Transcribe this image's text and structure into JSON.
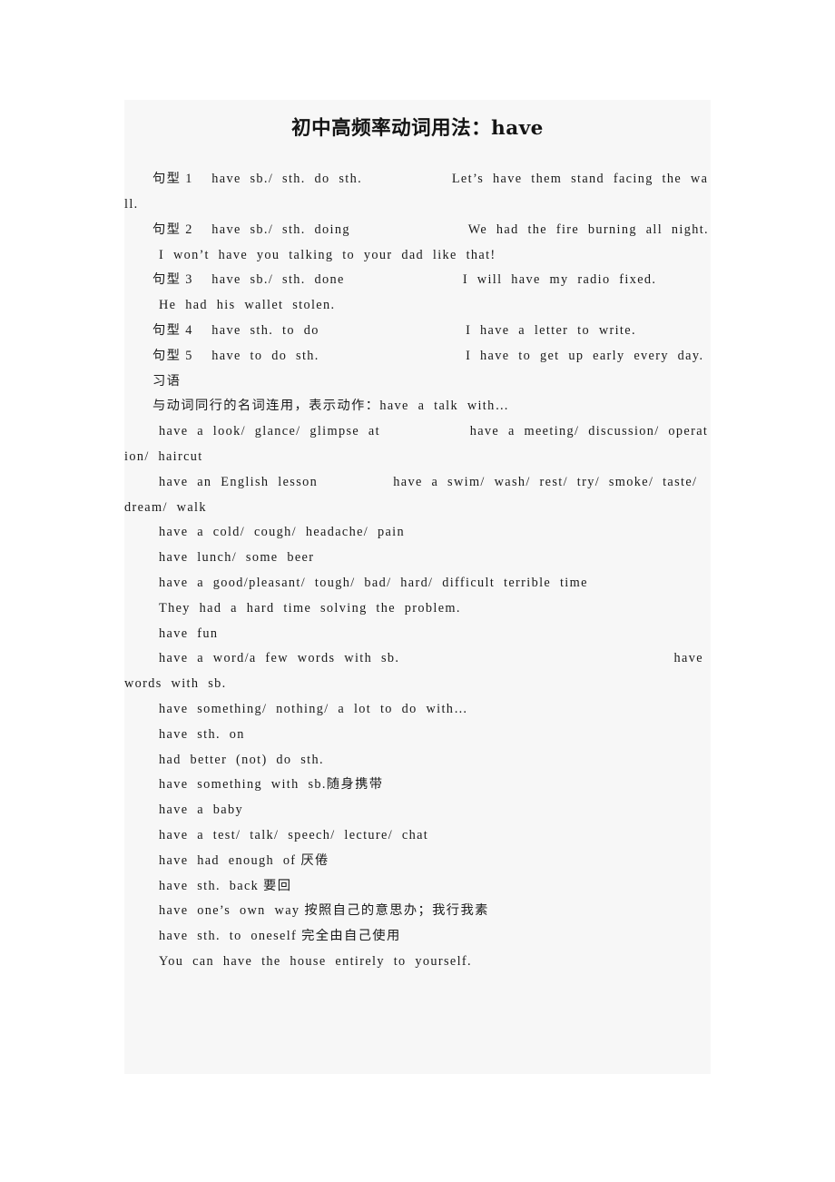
{
  "document": {
    "title": "初中高频率动词用法：have",
    "background_color": "#f7f7f7",
    "page_color": "#ffffff",
    "text_color": "#1a1a1a",
    "lines": [
      {
        "id": "pattern-1",
        "indent": "hang-pat",
        "text": "句型 1　 have  sb./  sth.  do  sth.　　　　　　 Let’s  have  them  stand  facing  the  wall."
      },
      {
        "id": "pattern-2",
        "indent": "hang-pat",
        "text": "句型 2　 have  sb./  sth.  doing　　　　　　　　 We  had  the  fire  burning  all  night."
      },
      {
        "id": "example-2b",
        "indent": "hang-item",
        "text": "I  won’t  have  you  talking  to  your  dad  like  that!"
      },
      {
        "id": "pattern-3",
        "indent": "hang-pat",
        "text": "句型 3　 have  sb./  sth.  done　　　　　　　　 I  will  have  my  radio  fixed."
      },
      {
        "id": "example-3b",
        "indent": "hang-item",
        "text": "He  had  his  wallet  stolen."
      },
      {
        "id": "pattern-4",
        "indent": "hang-pat",
        "text": "句型 4　 have  sth.  to  do　　　　　　　　　　 I  have  a  letter  to  write."
      },
      {
        "id": "pattern-5",
        "indent": "hang-pat",
        "text": "句型 5　 have  to  do  sth.　　　　　　　　　　 I  have  to  get  up  early  every  day."
      },
      {
        "id": "idiom-heading",
        "indent": "i3",
        "text": "习语"
      },
      {
        "id": "idiom-intro",
        "indent": "i3",
        "text": "与动词同行的名词连用，表示动作：have  a  talk  with…"
      },
      {
        "id": "idiom-look",
        "indent": "hang-item",
        "text": "have  a  look/  glance/  glimpse  at　　　　　　 have  a  meeting/  discussion/  operation/  haircut"
      },
      {
        "id": "idiom-lesson",
        "indent": "hang-item",
        "text": "have  an  English  lesson　　　　　 have  a  swim/  wash/  rest/  try/  smoke/  taste/  dream/  walk"
      },
      {
        "id": "idiom-cold",
        "indent": "hang-item",
        "text": "have  a  cold/  cough/  headache/  pain"
      },
      {
        "id": "idiom-lunch",
        "indent": "hang-item",
        "text": "have  lunch/  some  beer"
      },
      {
        "id": "idiom-time",
        "indent": "hang-item",
        "text": "have  a  good/pleasant/  tough/  bad/  hard/  difficult  terrible  time"
      },
      {
        "id": "example-hardtime",
        "indent": "hang-item",
        "text": "They  had  a  hard  time  solving  the  problem."
      },
      {
        "id": "idiom-fun",
        "indent": "hang-item",
        "text": "have  fun"
      },
      {
        "id": "idiom-word",
        "indent": "hang-item",
        "text": "have  a  word/a  few  words  with  sb.　　　　　　　　　　　　　　　　　　　 have  words  with  sb."
      },
      {
        "id": "idiom-something",
        "indent": "hang-item",
        "text": "have  something/  nothing/  a  lot  to  do  with…"
      },
      {
        "id": "idiom-sth-on",
        "indent": "hang-item",
        "text": "have  sth.  on"
      },
      {
        "id": "idiom-had-better",
        "indent": "hang-item",
        "text": "had  better  (not)  do  sth."
      },
      {
        "id": "idiom-carry",
        "indent": "hang-item",
        "text": "have  something  with  sb.随身携带"
      },
      {
        "id": "idiom-baby",
        "indent": "hang-item",
        "text": "have  a  baby"
      },
      {
        "id": "idiom-test",
        "indent": "hang-item",
        "text": "have  a  test/  talk/  speech/  lecture/  chat"
      },
      {
        "id": "idiom-enough",
        "indent": "hang-item",
        "text": "have  had  enough  of 厌倦"
      },
      {
        "id": "idiom-back",
        "indent": "hang-item",
        "text": "have  sth.  back 要回"
      },
      {
        "id": "idiom-own-way",
        "indent": "hang-item",
        "text": "have  one’s  own  way 按照自己的意思办；我行我素"
      },
      {
        "id": "idiom-to-oneself",
        "indent": "hang-item",
        "text": "have  sth.  to  oneself 完全由自己使用"
      },
      {
        "id": "example-house",
        "indent": "hang-item",
        "text": "You  can  have  the  house  entirely  to  yourself."
      }
    ]
  }
}
